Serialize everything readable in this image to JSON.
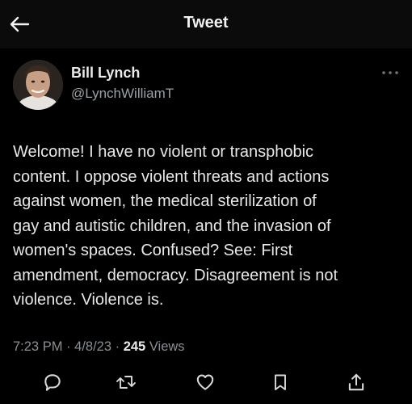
{
  "header": {
    "title": "Tweet",
    "back_icon": "arrow-left-icon"
  },
  "author": {
    "name": "Bill Lynch",
    "handle": "@LynchWilliamT",
    "more_icon": "more-horizontal-icon"
  },
  "tweet": {
    "text": "Welcome! I have no violent or transphobic\ncontent. I oppose violent threats and actions\nagainst women, the medical sterilization of\ngay and autistic children, and the invasion of\nwomen's spaces. Confused? See: First\namendment, democracy. Disagreement is not\nviolence. Violence is.",
    "time": "7:23 PM",
    "date": "4/8/23",
    "separator": "·",
    "views_count": "245",
    "views_label": "Views"
  },
  "actions": [
    {
      "name": "reply",
      "icon": "reply-icon"
    },
    {
      "name": "retweet",
      "icon": "retweet-icon"
    },
    {
      "name": "like",
      "icon": "heart-icon"
    },
    {
      "name": "bookmark",
      "icon": "bookmark-icon"
    },
    {
      "name": "share",
      "icon": "share-icon"
    }
  ],
  "colors": {
    "background": "#000000",
    "header_background": "#0b0b0b",
    "text_primary": "#e7e9ea",
    "text_secondary": "#8a8f94"
  }
}
